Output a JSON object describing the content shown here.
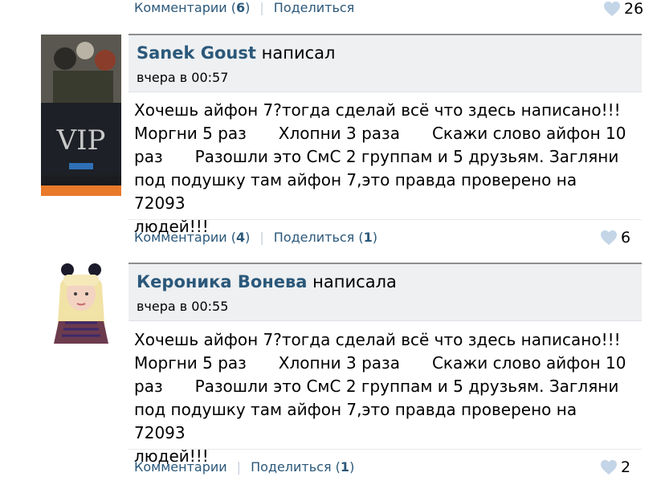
{
  "top_actions": {
    "comments_label": "Комментарии",
    "comments_count": "6",
    "share_label": "Поделиться",
    "likes": "26"
  },
  "posts": [
    {
      "author": "Sanek Goust",
      "verb": "написал",
      "date": "вчера в 00:57",
      "lines": [
        [
          "Хочешь айфон 7?тогда сделай всё что здесь написано!!!"
        ],
        [
          "Моргни 5 раз",
          "Хлопни 3 раза",
          "Скажи слово айфон 10"
        ],
        [
          "раз",
          "Разошли это СмС 2 группам и 5 друзьям. Загляни"
        ],
        [
          "под подушку там айфон 7,это правда проверено на 72093"
        ],
        [
          "людей!!!"
        ]
      ],
      "comments_label": "Комментарии",
      "comments_count": "4",
      "share_label": "Поделиться",
      "share_count": "1",
      "likes": "6",
      "avatar_text": "VIP"
    },
    {
      "author": "Кероника Вонева",
      "verb": "написала",
      "date": "вчера в 00:55",
      "lines": [
        [
          "Хочешь айфон 7?тогда сделай всё что здесь написано!!!"
        ],
        [
          "Моргни 5 раз",
          "Хлопни 3 раза",
          "Скажи слово айфон 10"
        ],
        [
          "раз",
          "Разошли это СмС 2 группам и 5 друзьям. Загляни"
        ],
        [
          "под подушку там айфон 7,это правда проверено на 72093"
        ],
        [
          "людей!!!"
        ]
      ],
      "comments_label": "Комментарии",
      "share_label": "Поделиться",
      "share_count": "1",
      "likes": "2"
    }
  ],
  "colors": {
    "link": "#2b587a",
    "header_bg": "#eef0f2"
  }
}
